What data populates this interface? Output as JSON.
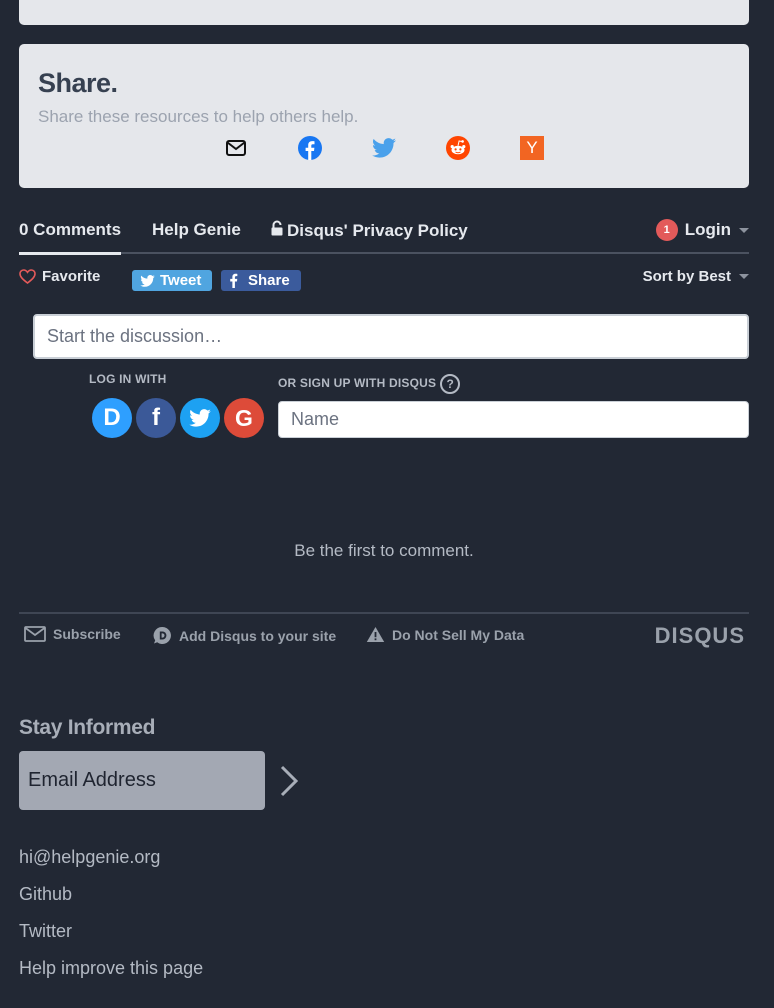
{
  "share": {
    "title": "Share.",
    "subtitle": "Share these resources to help others help.",
    "icons": [
      "mail-icon",
      "facebook-icon",
      "twitter-icon",
      "reddit-icon",
      "hacker-news-icon"
    ],
    "hn_glyph": "Y",
    "colors": {
      "facebook": "#1877f2",
      "twitter": "#4aa1eb",
      "reddit": "#ff4500",
      "hacker_news": "#f26522"
    }
  },
  "disqus": {
    "tabs": {
      "comments": "0 Comments",
      "community": "Help Genie",
      "privacy": "Disqus' Privacy Policy"
    },
    "login": {
      "badge": "1",
      "label": "Login"
    },
    "favorite": "Favorite",
    "tweet": "Tweet",
    "share": "Share",
    "sort": "Sort by Best",
    "start_placeholder": "Start the discussion…",
    "log_in_with": "LOG IN WITH",
    "sign_up_with": "OR SIGN UP WITH DISQUS",
    "help_glyph": "?",
    "name_placeholder": "Name",
    "social": [
      "disqus",
      "facebook",
      "twitter",
      "google"
    ],
    "social_glyphs": {
      "disqus": "D",
      "facebook": "f",
      "google": "G"
    },
    "empty_message": "Be the first to comment.",
    "footer": {
      "subscribe": "Subscribe",
      "add_disqus": "Add Disqus to your site",
      "do_not_sell": "Do Not Sell My Data",
      "logo": "DISQUS"
    }
  },
  "newsletter": {
    "title": "Stay Informed",
    "email_placeholder": "Email Address"
  },
  "links": [
    "hi@helpgenie.org",
    "Github",
    "Twitter",
    "Help improve this page"
  ]
}
